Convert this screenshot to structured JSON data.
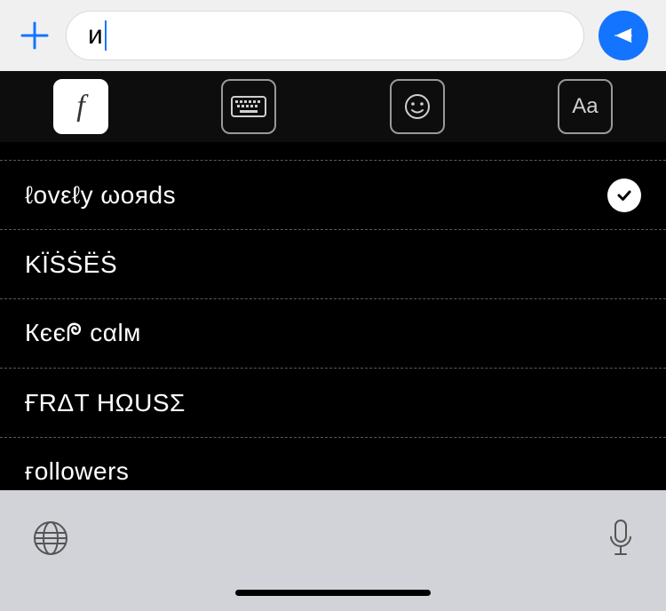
{
  "input": {
    "value": "и"
  },
  "tabs": {
    "font": "f",
    "aa": "Aa"
  },
  "fonts": [
    {
      "label": "ℓovεℓy ωoяds",
      "selected": true
    },
    {
      "label": "KÏṠṠЁṠ",
      "selected": false
    },
    {
      "label": "Кєєᖘ cαlм",
      "selected": false
    },
    {
      "label": "ҒRΔT HΩUSΣ",
      "selected": false
    },
    {
      "label": "ғollowers",
      "selected": false
    }
  ]
}
